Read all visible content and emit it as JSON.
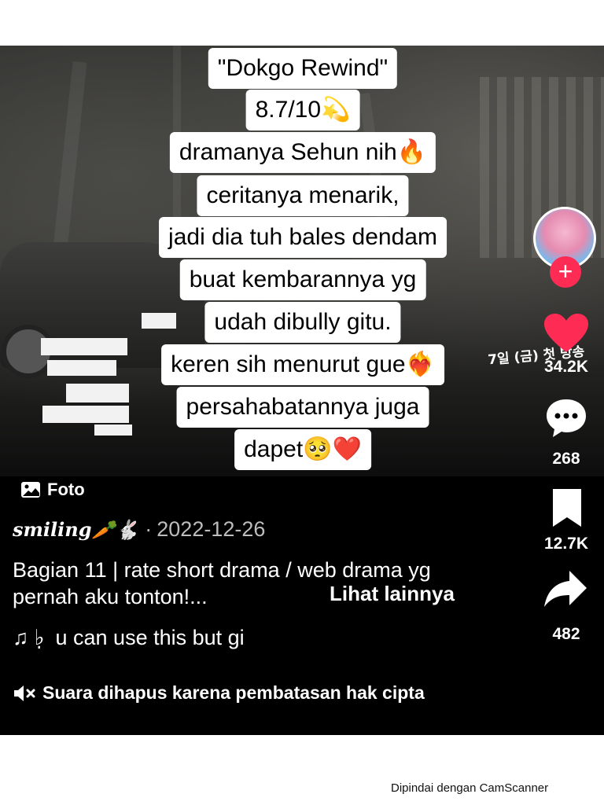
{
  "caption": {
    "lines": [
      "\"Dokgo Rewind\"",
      "8.7/10💫",
      "dramanya Sehun nih🔥",
      "ceritanya menarik,",
      "jadi dia tuh bales dendam",
      "buat kembarannya yg",
      "udah dibully gitu.",
      "keren sih menurut gue❤️‍🔥",
      "persahabatannya juga",
      "dapet🥺❤️"
    ]
  },
  "poster": {
    "korean_text": "7일 (금) 첫 방송"
  },
  "actions": {
    "follow_symbol": "+",
    "likes": "34.2K",
    "comments": "268",
    "saves": "12.7K",
    "shares": "482",
    "like_color": "#fe2c55",
    "follow_color": "#fe2c55"
  },
  "post": {
    "type_label": "Foto",
    "username": "smiling🥕🐇",
    "separator": "·",
    "date": "2022-12-26",
    "description": "Bagian 11 | rate short drama / web drama yg pernah aku tonton!...",
    "see_more": "Lihat lainnya",
    "music_prefix": "♫ ♭̣",
    "music": "u can use this but gi",
    "mute_notice": "Suara dihapus karena pembatasan hak cipta"
  },
  "watermark": "Dipindai dengan CamScanner",
  "icons": [
    "photo-icon",
    "music-note-icon",
    "muted-speaker-icon",
    "heart-icon",
    "comment-icon",
    "bookmark-icon",
    "share-icon",
    "plus-icon"
  ]
}
